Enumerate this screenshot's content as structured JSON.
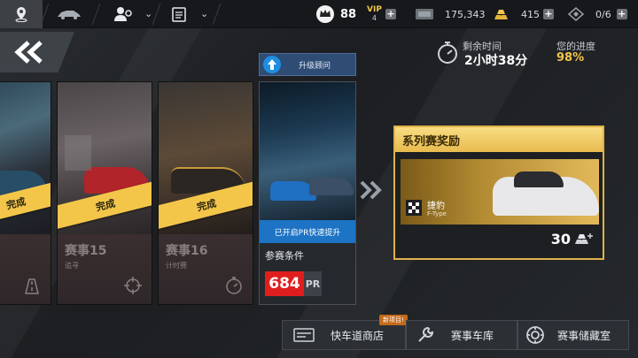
{
  "topbar": {
    "nav_tabs": [
      {
        "name": "map"
      },
      {
        "name": "garage"
      },
      {
        "name": "profile"
      },
      {
        "name": "tasks"
      }
    ],
    "resources": {
      "level": "88",
      "vip_label": "VIP",
      "vip_level": "4",
      "cash": "175,343",
      "gold": "415",
      "tickets": "0/6"
    }
  },
  "advisor": {
    "label": "升级顾问"
  },
  "timer": {
    "label": "剩余时间",
    "value": "2小时38分"
  },
  "progress": {
    "label": "您的进度",
    "value": "98%"
  },
  "cards": [
    {
      "ribbon": "完成",
      "title": "",
      "sub": ""
    },
    {
      "ribbon": "完成",
      "title": "赛事15",
      "sub": "追寻"
    },
    {
      "ribbon": "完成",
      "title": "赛事16",
      "sub": "计时赛"
    }
  ],
  "active_card": {
    "banner": "已开启PR快速提升",
    "req_label": "参赛条件",
    "pr_value": "684",
    "pr_tag": "PR"
  },
  "reward": {
    "title": "系列赛奖励",
    "brand": "捷豹",
    "model": "F-Type",
    "amount": "30"
  },
  "bottom_buttons": {
    "shop": "快车道商店",
    "new_badge": "新项目!",
    "garage": "赛事车库",
    "vault": "赛事储藏室"
  },
  "colors": {
    "accent": "#f3c64a",
    "pr_red": "#e01e1e",
    "blue_banner": "#1d73c4"
  }
}
